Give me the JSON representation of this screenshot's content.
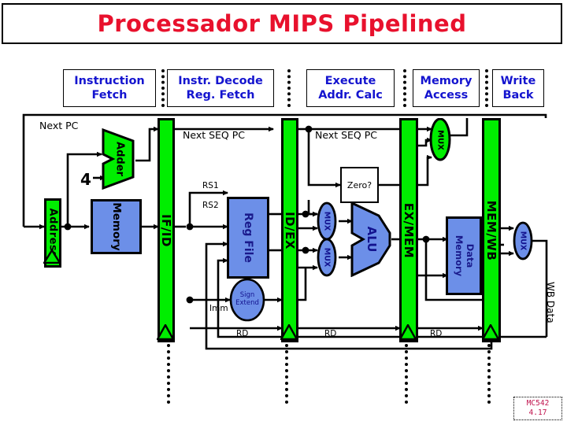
{
  "title": "Processador MIPS Pipelined",
  "colors": {
    "title_red": "#e8112d",
    "stage_blue": "#1414cf",
    "register_green": "#00ee00",
    "block_blue": "#6c8fe8",
    "footer_red": "#c0134d",
    "wire_black": "#000000"
  },
  "stages": [
    {
      "line1": "Instruction",
      "line2": "Fetch"
    },
    {
      "line1": "Instr. Decode",
      "line2": "Reg. Fetch"
    },
    {
      "line1": "Execute",
      "line2": "Addr. Calc"
    },
    {
      "line1": "Memory",
      "line2": "Access"
    },
    {
      "line1": "Write",
      "line2": "Back"
    }
  ],
  "pipeline_registers": [
    {
      "label": "IF/ID"
    },
    {
      "label": "ID/EX"
    },
    {
      "label": "EX/MEM"
    },
    {
      "label": "MEM/WB"
    }
  ],
  "units": {
    "address_register": "Address",
    "instruction_memory": "Memory",
    "adder": "Adder",
    "reg_file": "Reg File",
    "sign_extend_l1": "Sign",
    "sign_extend_l2": "Extend",
    "alu": "ALU",
    "data_memory_l1": "Data",
    "data_memory_l2": "Memory",
    "zero_test": "Zero?",
    "mux": "MUX"
  },
  "signals": {
    "next_pc": "Next PC",
    "next_seq_pc_1": "Next SEQ PC",
    "next_seq_pc_2": "Next SEQ PC",
    "four": "4",
    "rs1": "RS1",
    "rs2": "RS2",
    "imm": "Imm",
    "rd_1": "RD",
    "rd_2": "RD",
    "rd_3": "RD",
    "wb_data": "WB Data"
  },
  "footer": {
    "course": "MC542",
    "slide": "4.17"
  }
}
